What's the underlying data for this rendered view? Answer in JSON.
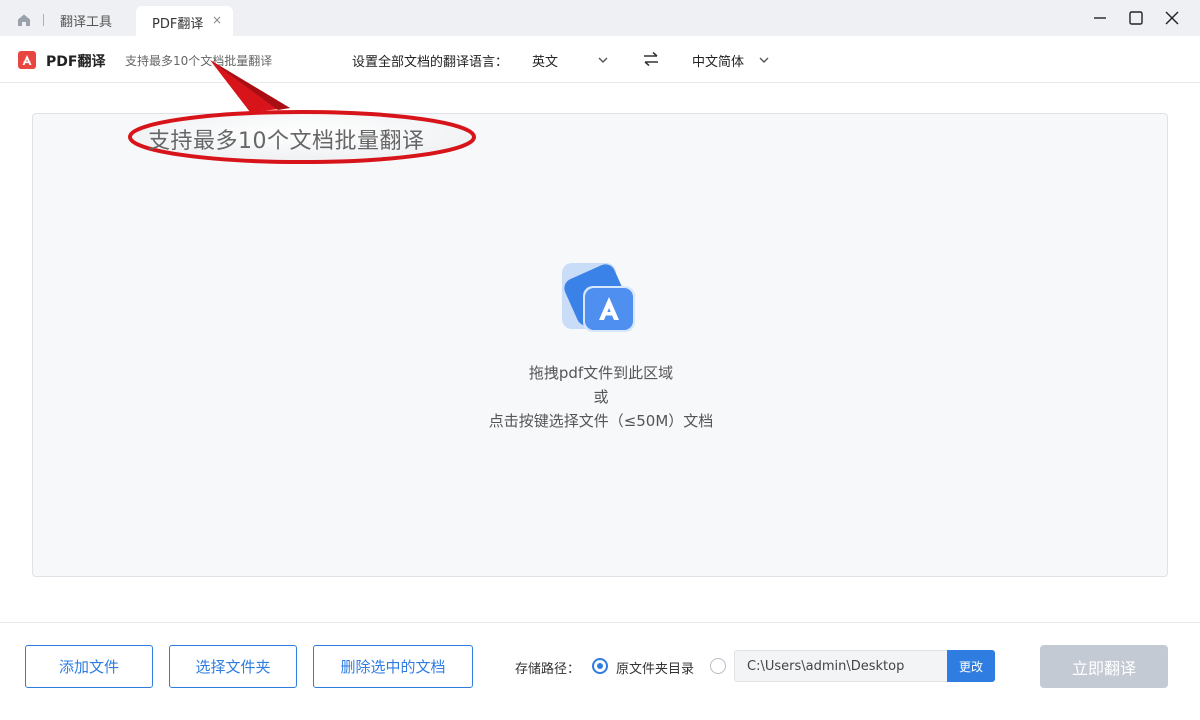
{
  "window": {
    "tabs": [
      {
        "label": "翻译工具"
      },
      {
        "label": "PDF翻译",
        "close": "×"
      }
    ]
  },
  "toolbar": {
    "app_name": "PDF翻译",
    "hint": "支持最多10个文档批量翻译",
    "lang_label": "设置全部文档的翻译语言：",
    "source_lang": "英文",
    "target_lang": "中文简体"
  },
  "dropzone": {
    "line1": "拖拽pdf文件到此区域",
    "line2": "或",
    "line3": "点击按键选择文件（≤50M）文档"
  },
  "callout": {
    "text": "支持最多10个文档批量翻译"
  },
  "bottom": {
    "add_file": "添加文件",
    "select_folder": "选择文件夹",
    "delete_selected": "删除选中的文档",
    "save_label": "存储路径：",
    "option_original": "原文件夹目录",
    "path_value": "C:\\Users\\admin\\Desktop",
    "change": "更改",
    "translate": "立即翻译"
  },
  "colors": {
    "accent": "#2f7de1",
    "logo_red": "#e8473f",
    "callout_red": "#d8141b",
    "disabled_button": "#c4cad3"
  },
  "icons": {
    "home": "home-icon",
    "close_tab": "close-icon",
    "minimize": "minimize-icon",
    "maximize": "maximize-icon",
    "close_window": "close-icon",
    "app_logo": "pdf-logo-icon",
    "chevron": "chevron-down-icon",
    "swap": "swap-icon",
    "upload": "pdf-upload-icon"
  }
}
